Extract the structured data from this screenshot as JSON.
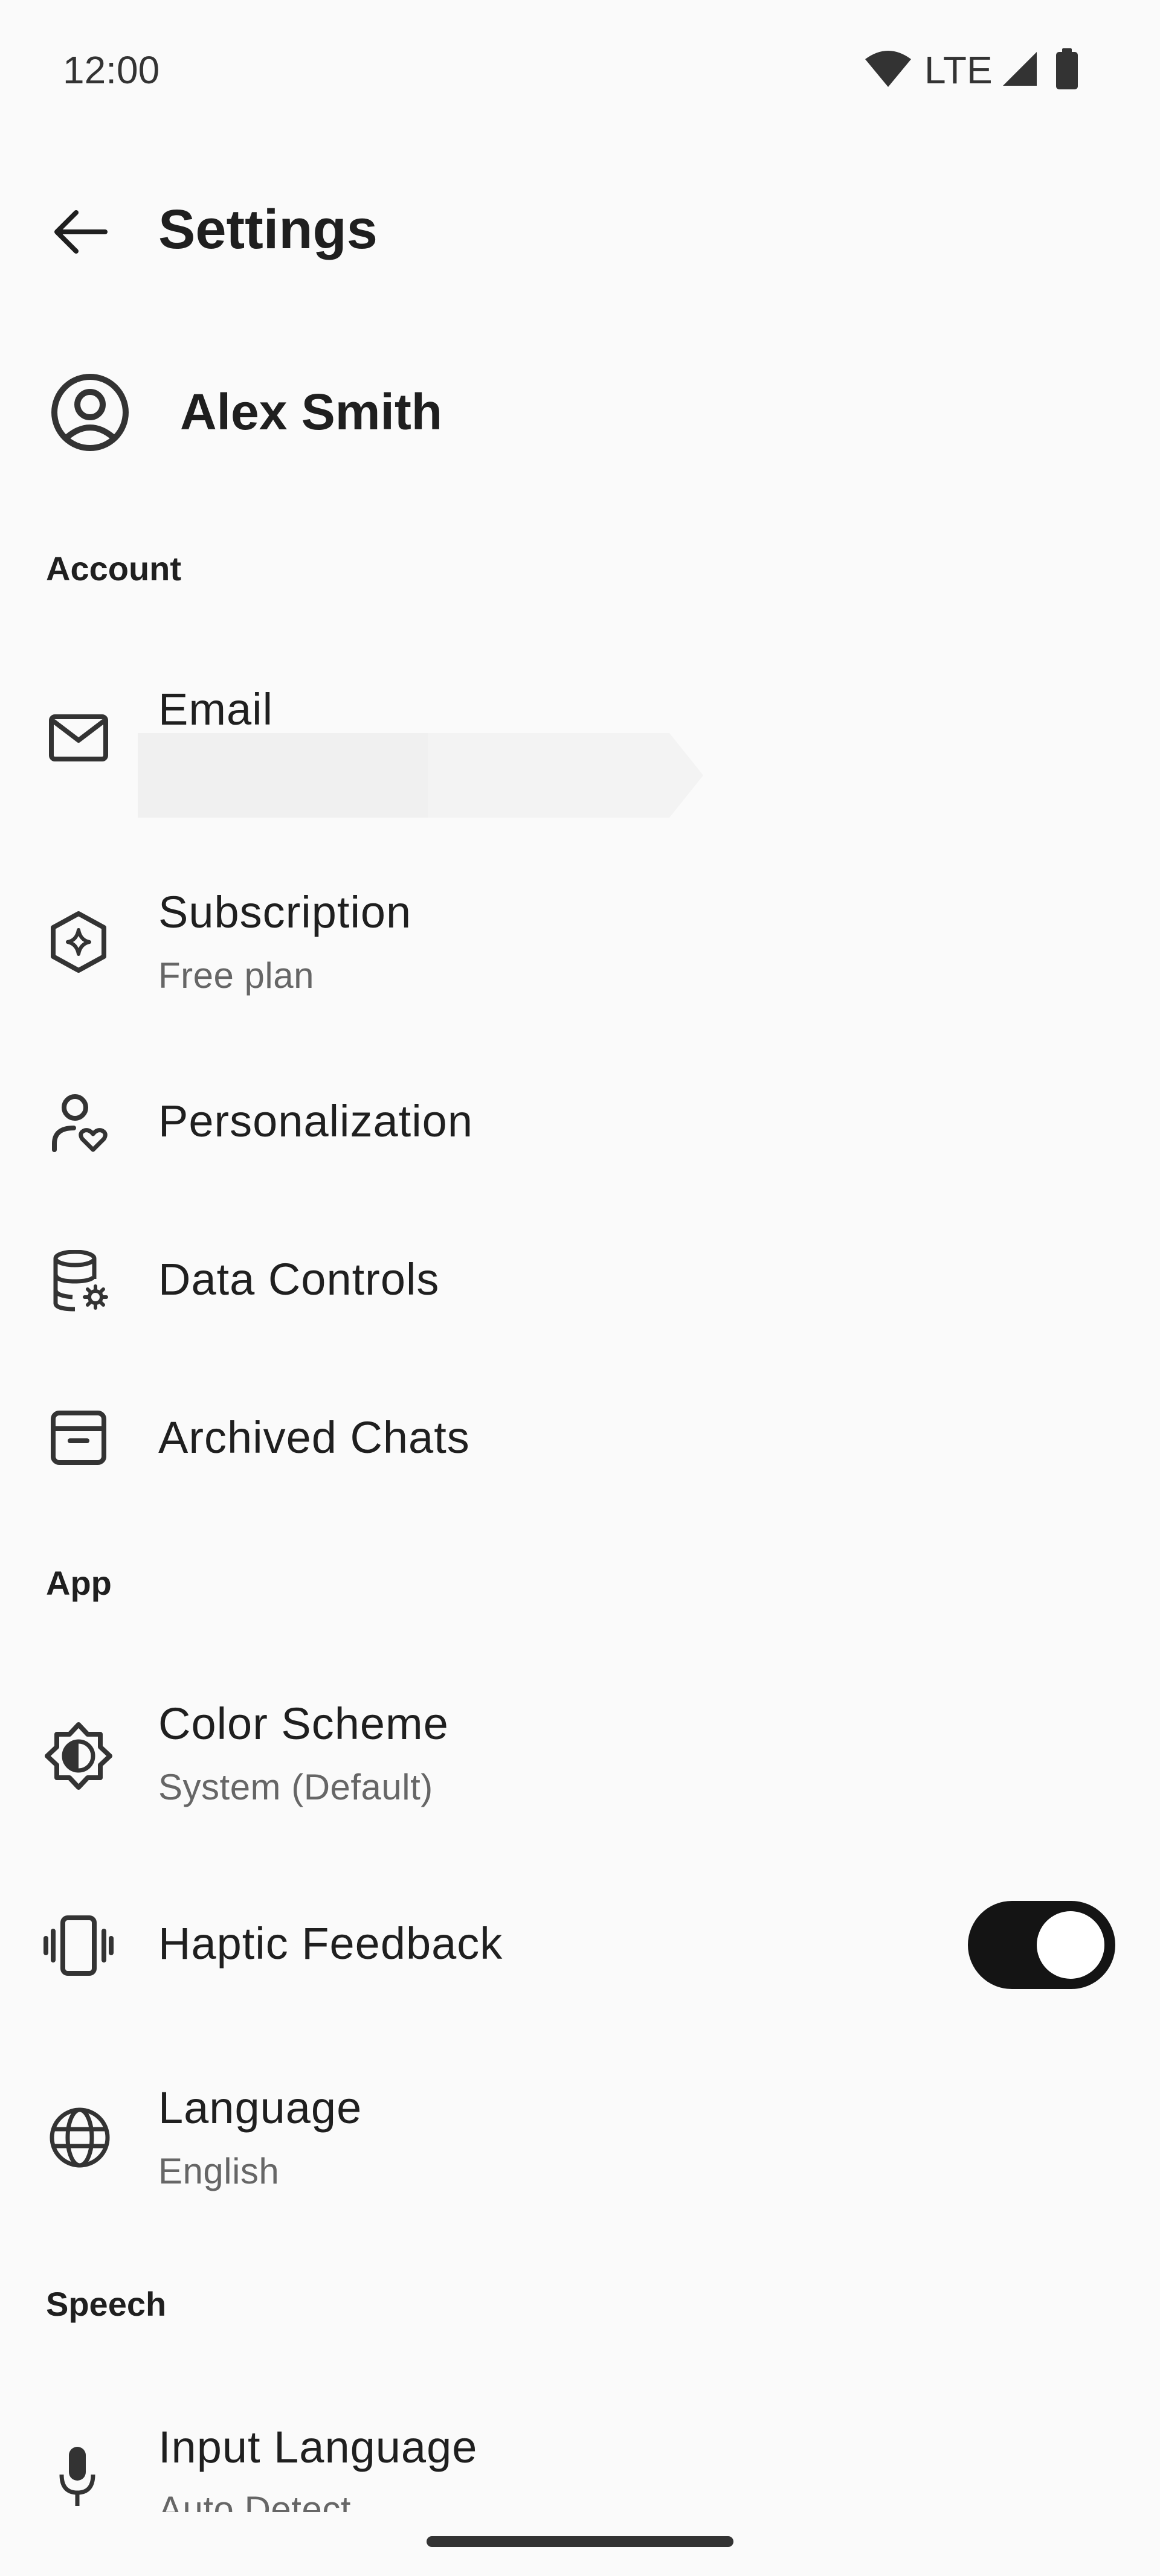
{
  "status_bar": {
    "time": "12:00",
    "network": "LTE",
    "icons": [
      "wifi-icon",
      "signal-icon",
      "battery-icon"
    ]
  },
  "header": {
    "title": "Settings",
    "back_icon": "arrow-back-icon"
  },
  "profile": {
    "name": "Alex Smith",
    "icon": "account-circle-icon"
  },
  "sections": {
    "account": "Account",
    "app": "App",
    "speech": "Speech"
  },
  "rows": {
    "email": {
      "title": "Email",
      "icon": "mail-icon"
    },
    "subscription": {
      "title": "Subscription",
      "subtitle": "Free plan",
      "icon": "sparkle-badge-icon"
    },
    "personalization": {
      "title": "Personalization",
      "icon": "person-heart-icon"
    },
    "data_controls": {
      "title": "Data Controls",
      "icon": "database-gear-icon"
    },
    "archived_chats": {
      "title": "Archived Chats",
      "icon": "archive-icon"
    },
    "color_scheme": {
      "title": "Color Scheme",
      "subtitle": "System (Default)",
      "icon": "brightness-icon"
    },
    "haptic_feedback": {
      "title": "Haptic Feedback",
      "icon": "vibration-icon",
      "enabled": true
    },
    "language": {
      "title": "Language",
      "subtitle": "English",
      "icon": "globe-icon"
    },
    "input_language": {
      "title": "Input Language",
      "subtitle": "Auto Detect",
      "icon": "mic-icon"
    }
  },
  "colors": {
    "background": "#fafafa",
    "toggle_on": "#141414",
    "text_primary": "#1f1f1f",
    "text_secondary": "#666666"
  }
}
